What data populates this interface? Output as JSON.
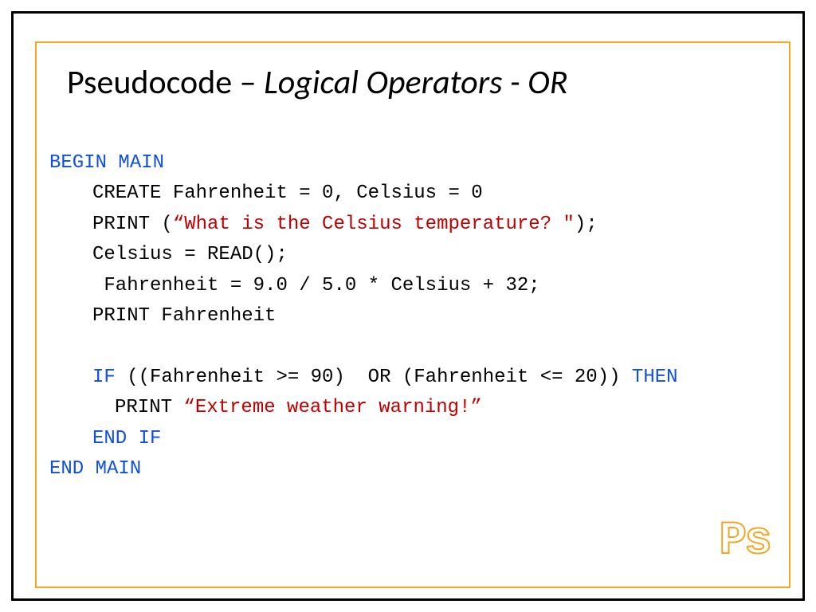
{
  "title": {
    "prefix": "Pseudocode – ",
    "italic": "Logical Operators - OR"
  },
  "code": {
    "l1": "BEGIN MAIN",
    "l2": "CREATE Fahrenheit = 0, Celsius = 0",
    "l3a": "PRINT (",
    "l3b": "“What is the Celsius temperature? \"",
    "l3c": ");",
    "l4": "Celsius = READ();",
    "l5": " Fahrenheit = 9.0 / 5.0 * Celsius + 32;",
    "l6": "PRINT Fahrenheit",
    "l7a": "IF",
    "l7b": " ((Fahrenheit >= 90)  OR (Fahrenheit <= 20)) ",
    "l7c": "THEN",
    "l8a": "PRINT ",
    "l8b": "“Extreme weather warning!”",
    "l9": "END IF",
    "l10": "END MAIN"
  },
  "logo": "Ps"
}
